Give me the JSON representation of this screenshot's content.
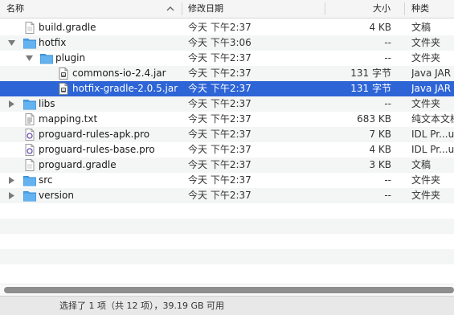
{
  "header": {
    "name": "名称",
    "date": "修改日期",
    "size": "大小",
    "kind": "种类"
  },
  "rows": [
    {
      "name": "build.gradle",
      "icon": "file-icon",
      "date": "今天 下午2:37",
      "size": "4 KB",
      "kind": "文稿"
    },
    {
      "name": "hotfix",
      "icon": "folder-icon",
      "disclosure": "expanded",
      "date": "今天 下午3:06",
      "size": "--",
      "kind": "文件夹"
    },
    {
      "name": "plugin",
      "icon": "folder-icon",
      "disclosure": "expanded",
      "date": "今天 下午2:37",
      "size": "--",
      "kind": "文件夹"
    },
    {
      "name": "commons-io-2.4.jar",
      "icon": "jar-file-icon",
      "date": "今天 下午2:37",
      "size": "131 字节",
      "kind": "Java JAR"
    },
    {
      "name": "hotfix-gradle-2.0.5.jar",
      "icon": "jar-file-icon",
      "date": "今天 下午2:37",
      "size": "131 字节",
      "kind": "Java JAR",
      "selected": true
    },
    {
      "name": "libs",
      "icon": "folder-icon",
      "disclosure": "collapsed",
      "date": "今天 下午2:37",
      "size": "--",
      "kind": "文件夹"
    },
    {
      "name": "mapping.txt",
      "icon": "text-file-icon",
      "date": "今天 下午2:37",
      "size": "683 KB",
      "kind": "纯文本文档"
    },
    {
      "name": "proguard-rules-apk.pro",
      "icon": "pro-file-icon",
      "date": "今天 下午2:37",
      "size": "7 KB",
      "kind": "IDL Pr...ure"
    },
    {
      "name": "proguard-rules-base.pro",
      "icon": "pro-file-icon",
      "date": "今天 下午2:37",
      "size": "4 KB",
      "kind": "IDL Pr...ure"
    },
    {
      "name": "proguard.gradle",
      "icon": "file-icon",
      "date": "今天 下午2:37",
      "size": "3 KB",
      "kind": "文稿"
    },
    {
      "name": "src",
      "icon": "folder-icon",
      "disclosure": "collapsed",
      "date": "今天 下午2:37",
      "size": "--",
      "kind": "文件夹"
    },
    {
      "name": "version",
      "icon": "folder-icon",
      "disclosure": "collapsed",
      "date": "今天 下午2:37",
      "size": "--",
      "kind": "文件夹"
    }
  ],
  "status": "选择了 1 项（共 12 项），39.19 GB 可用",
  "colors": {
    "selection": "#2d64d6",
    "folder": "#4ba3e8"
  }
}
